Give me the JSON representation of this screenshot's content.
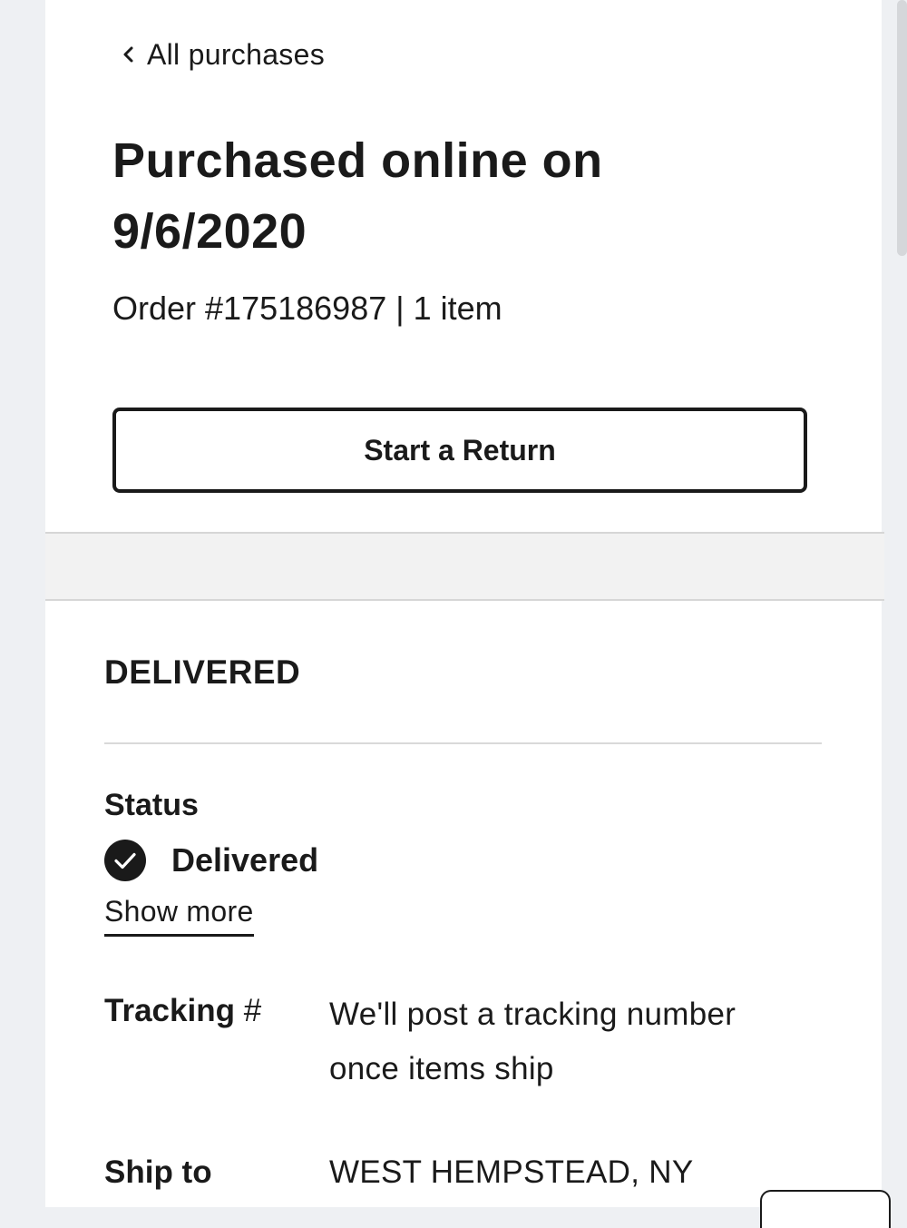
{
  "nav": {
    "back_label": "All purchases"
  },
  "header": {
    "title": "Purchased online on 9/6/2020",
    "order_summary": "Order #175186987 | 1 item"
  },
  "actions": {
    "start_return_label": "Start a Return"
  },
  "shipment": {
    "heading": "DELIVERED",
    "status_label": "Status",
    "status_value": "Delivered",
    "show_more_label": "Show more",
    "tracking_label": "Tracking",
    "tracking_hash": "#",
    "tracking_value": "We'll post a tracking number once items ship",
    "ship_to_label": "Ship to",
    "ship_to_value": "WEST HEMPSTEAD, NY"
  },
  "icons": {
    "back": "chevron-left-icon",
    "status": "check-circle-icon"
  },
  "colors": {
    "text": "#1a1a1a",
    "background": "#eef0f3",
    "panel": "#ffffff",
    "divider": "#d9d9d9"
  }
}
